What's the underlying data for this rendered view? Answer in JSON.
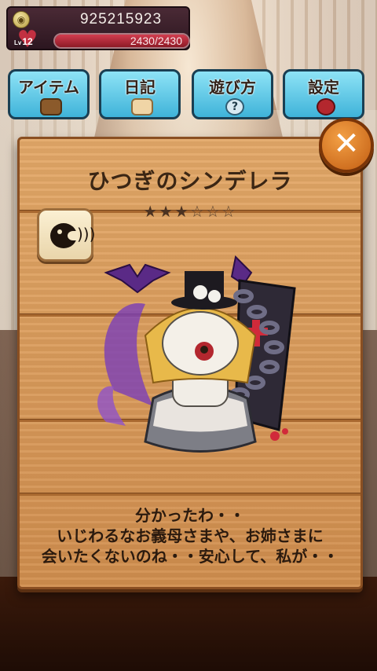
{
  "status": {
    "coins": "925215923",
    "level_prefix": "Lv",
    "level": "12",
    "hp_text": "2430/2430",
    "hp_fraction": 1.0
  },
  "menu": [
    {
      "id": "tab-item",
      "label": "アイテム",
      "icon": "chest-icon"
    },
    {
      "id": "tab-diary",
      "label": "日記",
      "icon": "book-icon"
    },
    {
      "id": "tab-howto",
      "label": "遊び方",
      "icon": "question-icon"
    },
    {
      "id": "tab-settings",
      "label": "設定",
      "icon": "gear-icon"
    }
  ],
  "card": {
    "title": "ひつぎのシンデレラ",
    "rating": 3,
    "rating_max": 6,
    "dialogue": [
      "分かったわ・・",
      "いじわるなお義母さまや、お姉さまに",
      "会いたくないのね・・安心して、私が・・"
    ]
  },
  "icons": {
    "voice": "voice-speaker-icon",
    "close": "close-icon",
    "coin": "coin-icon",
    "heart": "heart-icon"
  },
  "colors": {
    "accent_orange": "#e07a1f",
    "tab_blue": "#5cc6e6",
    "hp_red": "#c23041",
    "wood": "#d99a5a"
  }
}
